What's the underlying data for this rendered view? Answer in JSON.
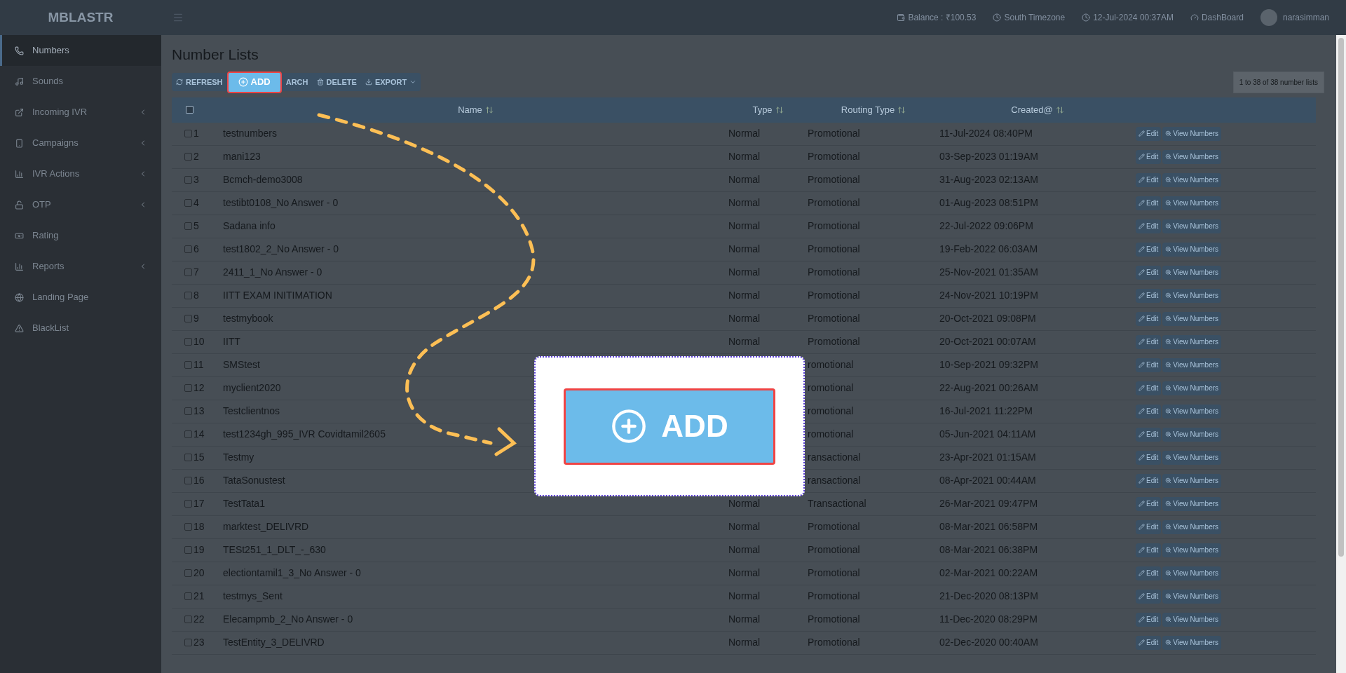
{
  "topbar": {
    "brand": "MBLASTR",
    "items": [
      {
        "kind": "balance",
        "label": "Balance : ₹100.53"
      },
      {
        "kind": "timezone",
        "label": "South Timezone"
      },
      {
        "kind": "clock",
        "label": "12-Jul-2024 00:37AM"
      },
      {
        "kind": "dashboard",
        "label": "DashBoard"
      },
      {
        "kind": "user",
        "label": "narasimman"
      }
    ]
  },
  "sidebar": {
    "items": [
      {
        "kind": "phone",
        "label": "Numbers",
        "selected": true,
        "submenu": false
      },
      {
        "kind": "music",
        "label": "Sounds",
        "selected": false,
        "submenu": false
      },
      {
        "kind": "external",
        "label": "Incoming IVR",
        "selected": false,
        "submenu": true
      },
      {
        "kind": "mobile",
        "label": "Campaigns",
        "selected": false,
        "submenu": true
      },
      {
        "kind": "chart",
        "label": "IVR Actions",
        "selected": false,
        "submenu": true
      },
      {
        "kind": "lock",
        "label": "OTP",
        "selected": false,
        "submenu": true
      },
      {
        "kind": "money",
        "label": "Rating",
        "selected": false,
        "submenu": false
      },
      {
        "kind": "chart",
        "label": "Reports",
        "selected": false,
        "submenu": true
      },
      {
        "kind": "globe",
        "label": "Landing Page",
        "selected": false,
        "submenu": false
      },
      {
        "kind": "warning",
        "label": "BlackList",
        "selected": false,
        "submenu": false
      }
    ]
  },
  "page_title": "Number Lists",
  "toolbar": [
    {
      "kind": "refresh",
      "label": "REFRESH",
      "highlighted": false
    },
    {
      "kind": "add",
      "label": "ADD",
      "highlighted": true
    },
    {
      "kind": "none",
      "label": "ARCH",
      "highlighted": false
    },
    {
      "kind": "delete",
      "label": "DELETE",
      "highlighted": false
    },
    {
      "kind": "export",
      "label": "EXPORT",
      "highlighted": false
    }
  ],
  "pagination": "1 to 38 of 38 number lists",
  "table": {
    "select_all_checked": false,
    "columns": [
      "Name",
      "Type",
      "Routing Type",
      "Created@"
    ],
    "rows": [
      {
        "index": "1",
        "name": "testnumbers",
        "type": "Normal",
        "routing_type": "Promotional",
        "created": "11-Jul-2024 08:40PM",
        "checked": false,
        "actions": [
          "Edit",
          "View Numbers"
        ]
      },
      {
        "index": "2",
        "name": "mani123",
        "type": "Normal",
        "routing_type": "Promotional",
        "created": "03-Sep-2023 01:19AM",
        "checked": false,
        "actions": [
          "Edit",
          "View Numbers"
        ]
      },
      {
        "index": "3",
        "name": "Bcmch-demo3008",
        "type": "Normal",
        "routing_type": "Promotional",
        "created": "31-Aug-2023 02:13AM",
        "checked": false,
        "actions": [
          "Edit",
          "View Numbers"
        ]
      },
      {
        "index": "4",
        "name": "testibt0108_No Answer - 0",
        "type": "Normal",
        "routing_type": "Promotional",
        "created": "01-Aug-2023 08:51PM",
        "checked": false,
        "actions": [
          "Edit",
          "View Numbers"
        ]
      },
      {
        "index": "5",
        "name": "Sadana info",
        "type": "Normal",
        "routing_type": "Promotional",
        "created": "22-Jul-2022 09:06PM",
        "checked": false,
        "actions": [
          "Edit",
          "View Numbers"
        ]
      },
      {
        "index": "6",
        "name": "test1802_2_No Answer - 0",
        "type": "Normal",
        "routing_type": "Promotional",
        "created": "19-Feb-2022 06:03AM",
        "checked": false,
        "actions": [
          "Edit",
          "View Numbers"
        ]
      },
      {
        "index": "7",
        "name": "2411_1_No Answer - 0",
        "type": "Normal",
        "routing_type": "Promotional",
        "created": "25-Nov-2021 01:35AM",
        "checked": false,
        "actions": [
          "Edit",
          "View Numbers"
        ]
      },
      {
        "index": "8",
        "name": "IITT EXAM INITIMATION",
        "type": "Normal",
        "routing_type": "Promotional",
        "created": "24-Nov-2021 10:19PM",
        "checked": false,
        "actions": [
          "Edit",
          "View Numbers"
        ]
      },
      {
        "index": "9",
        "name": "testmybook",
        "type": "Normal",
        "routing_type": "Promotional",
        "created": "20-Oct-2021 09:08PM",
        "checked": false,
        "actions": [
          "Edit",
          "View Numbers"
        ]
      },
      {
        "index": "10",
        "name": "IITT",
        "type": "Normal",
        "routing_type": "Promotional",
        "created": "20-Oct-2021 00:07AM",
        "checked": false,
        "actions": [
          "Edit",
          "View Numbers"
        ]
      },
      {
        "index": "11",
        "name": "SMStest",
        "routing_type": "romotional",
        "created": "10-Sep-2021 09:32PM",
        "checked": false,
        "actions": [
          "Edit",
          "View Numbers"
        ]
      },
      {
        "index": "12",
        "name": "myclient2020",
        "routing_type": "romotional",
        "created": "22-Aug-2021 00:26AM",
        "checked": false,
        "actions": [
          "Edit",
          "View Numbers"
        ]
      },
      {
        "index": "13",
        "name": "Testclientnos",
        "routing_type": "romotional",
        "created": "16-Jul-2021 11:22PM",
        "checked": false,
        "actions": [
          "Edit",
          "View Numbers"
        ]
      },
      {
        "index": "14",
        "name": "test1234gh_995_IVR Covidtamil2605",
        "routing_type": "romotional",
        "created": "05-Jun-2021 04:11AM",
        "checked": false,
        "actions": [
          "Edit",
          "View Numbers"
        ]
      },
      {
        "index": "15",
        "name": "Testmy",
        "routing_type": "ransactional",
        "created": "23-Apr-2021 01:15AM",
        "checked": false,
        "actions": [
          "Edit",
          "View Numbers"
        ]
      },
      {
        "index": "16",
        "name": "TataSonustest",
        "routing_type": "ransactional",
        "created": "08-Apr-2021 00:44AM",
        "checked": false,
        "actions": [
          "Edit",
          "View Numbers"
        ]
      },
      {
        "index": "17",
        "name": "TestTata1",
        "type": "Normal",
        "routing_type": "Transactional",
        "created": "26-Mar-2021 09:47PM",
        "checked": false,
        "actions": [
          "Edit",
          "View Numbers"
        ]
      },
      {
        "index": "18",
        "name": "marktest_DELIVRD",
        "type": "Normal",
        "routing_type": "Promotional",
        "created": "08-Mar-2021 06:58PM",
        "checked": false,
        "actions": [
          "Edit",
          "View Numbers"
        ]
      },
      {
        "index": "19",
        "name": "TESt251_1_DLT_-_630",
        "type": "Normal",
        "routing_type": "Promotional",
        "created": "08-Mar-2021 06:38PM",
        "checked": false,
        "actions": [
          "Edit",
          "View Numbers"
        ]
      },
      {
        "index": "20",
        "name": "electiontamil1_3_No Answer - 0",
        "type": "Normal",
        "routing_type": "Promotional",
        "created": "02-Mar-2021 00:22AM",
        "checked": false,
        "actions": [
          "Edit",
          "View Numbers"
        ]
      },
      {
        "index": "21",
        "name": "testmys_Sent",
        "type": "Normal",
        "routing_type": "Promotional",
        "created": "21-Dec-2020 08:13PM",
        "checked": false,
        "actions": [
          "Edit",
          "View Numbers"
        ]
      },
      {
        "index": "22",
        "name": "Elecampmb_2_No Answer - 0",
        "type": "Normal",
        "routing_type": "Promotional",
        "created": "11-Dec-2020 08:29PM",
        "checked": false,
        "actions": [
          "Edit",
          "View Numbers"
        ]
      },
      {
        "index": "23",
        "name": "TestEntity_3_DELIVRD",
        "type": "Normal",
        "routing_type": "Promotional",
        "created": "02-Dec-2020 00:40AM",
        "checked": false,
        "actions": [
          "Edit",
          "View Numbers"
        ]
      }
    ]
  },
  "callout": {
    "label": "ADD"
  }
}
